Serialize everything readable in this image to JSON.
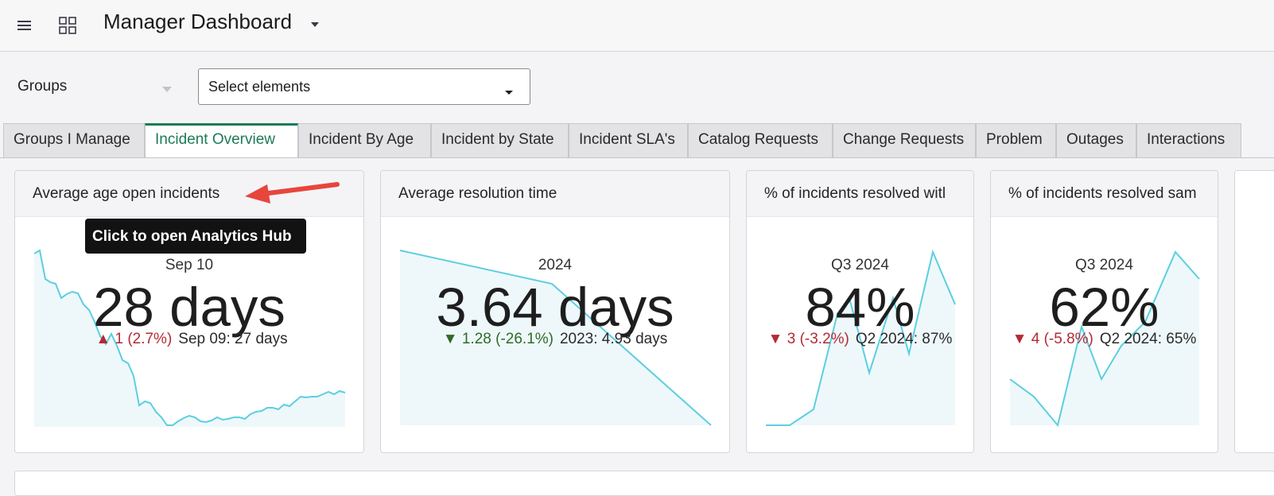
{
  "header": {
    "title": "Manager Dashboard",
    "menu_icon": "hamburger-menu-icon",
    "apps_icon": "grid-apps-icon"
  },
  "filters": {
    "groups_label": "Groups",
    "select_placeholder": "Select elements"
  },
  "tabs": [
    {
      "label": "Groups I Manage",
      "active": false
    },
    {
      "label": "Incident Overview",
      "active": true
    },
    {
      "label": "Incident By Age",
      "active": false
    },
    {
      "label": "Incident by State",
      "active": false
    },
    {
      "label": "Incident SLA's",
      "active": false
    },
    {
      "label": "Catalog Requests",
      "active": false
    },
    {
      "label": "Change Requests",
      "active": false
    },
    {
      "label": "Problem",
      "active": false
    },
    {
      "label": "Outages",
      "active": false
    },
    {
      "label": "Interactions",
      "active": false
    }
  ],
  "cards": [
    {
      "title": "Average age open incidents",
      "period": "Sep 10",
      "value": "28 days",
      "delta": "▲ 1 (2.7%)",
      "delta_direction": "up",
      "comparison": "Sep 09: 27 days"
    },
    {
      "title": "Average resolution time",
      "period": "2024",
      "value": "3.64 days",
      "delta": "▼ 1.28 (-26.1%)",
      "delta_direction": "down-good",
      "comparison": "2023: 4.93 days"
    },
    {
      "title": "% of incidents resolved witl",
      "period": "Q3 2024",
      "value": "84%",
      "delta": "▼ 3 (-3.2%)",
      "delta_direction": "down-bad",
      "comparison": "Q2 2024: 87%"
    },
    {
      "title": "% of incidents resolved sam",
      "period": "Q3 2024",
      "value": "62%",
      "delta": "▼ 4 (-5.8%)",
      "delta_direction": "down-bad",
      "comparison": "Q2 2024: 65%"
    }
  ],
  "tooltip": {
    "text": "Click to open Analytics Hub"
  },
  "colors": {
    "accent": "#1b7b56",
    "spark_line": "#5bcfe0",
    "spark_fill": "#eef8fb",
    "negative": "#b32a35",
    "positive": "#2f6b26",
    "annotation_arrow": "#e8453c"
  }
}
